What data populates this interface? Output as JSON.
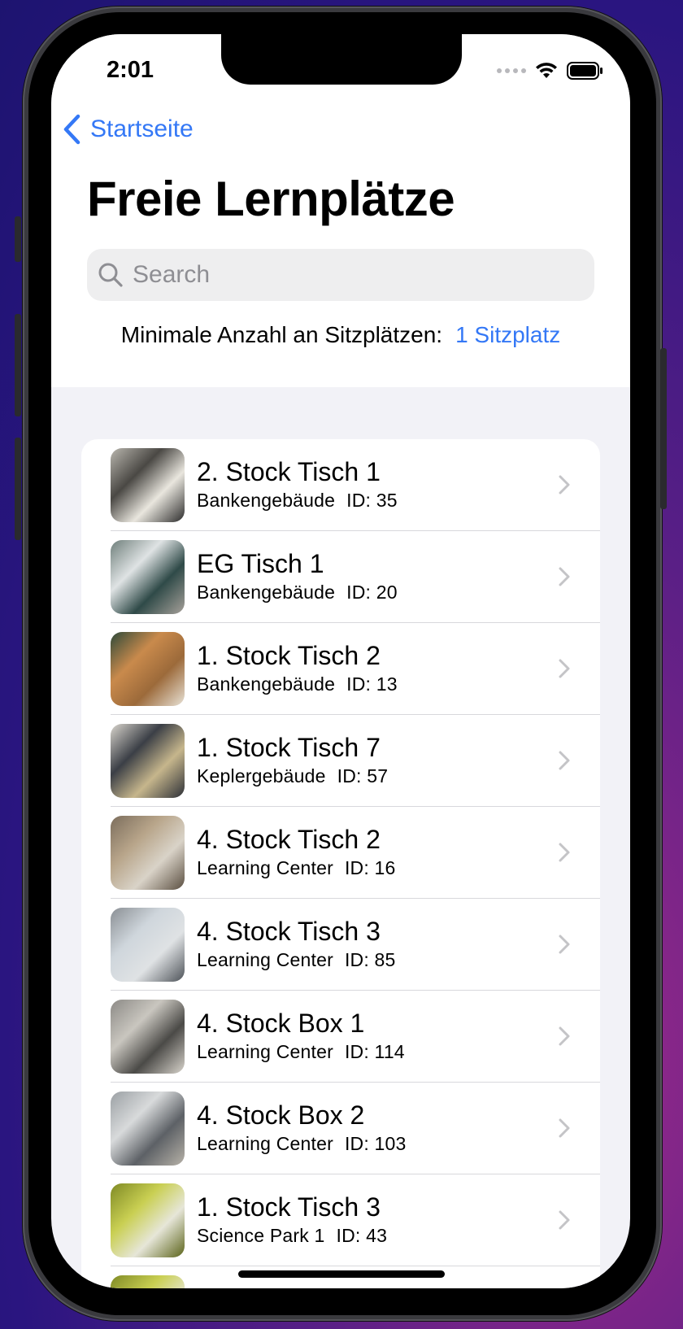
{
  "status": {
    "time": "2:01"
  },
  "nav": {
    "back_label": "Startseite",
    "title": "Freie Lernplätze"
  },
  "search": {
    "placeholder": "Search",
    "value": ""
  },
  "filter": {
    "label": "Minimale Anzahl an Sitzplätzen:",
    "value": "1 Sitzplatz"
  },
  "list": {
    "items": [
      {
        "title": "2. Stock Tisch 1",
        "building": "Bankengebäude",
        "id_text": "ID: 35"
      },
      {
        "title": "EG Tisch 1",
        "building": "Bankengebäude",
        "id_text": "ID: 20"
      },
      {
        "title": "1. Stock Tisch 2",
        "building": "Bankengebäude",
        "id_text": "ID: 13"
      },
      {
        "title": "1. Stock Tisch 7",
        "building": "Keplergebäude",
        "id_text": "ID: 57"
      },
      {
        "title": "4. Stock Tisch 2",
        "building": "Learning Center",
        "id_text": "ID: 16"
      },
      {
        "title": "4. Stock Tisch 3",
        "building": "Learning Center",
        "id_text": "ID: 85"
      },
      {
        "title": "4. Stock Box 1",
        "building": "Learning Center",
        "id_text": "ID: 114"
      },
      {
        "title": "4. Stock Box 2",
        "building": "Learning Center",
        "id_text": "ID: 103"
      },
      {
        "title": "1. Stock Tisch 3",
        "building": "Science Park 1",
        "id_text": "ID: 43"
      }
    ]
  },
  "colors": {
    "accent": "#3478f6",
    "background": "#f2f2f7"
  }
}
